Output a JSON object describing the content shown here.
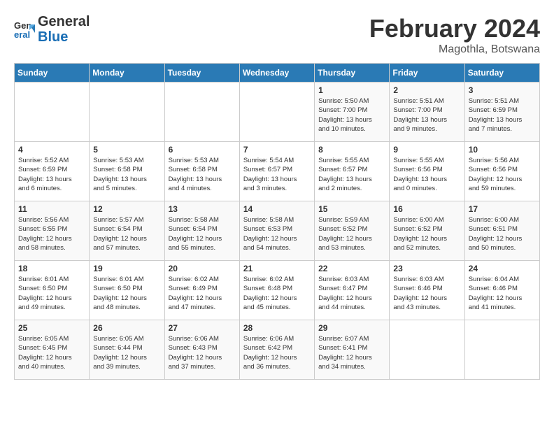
{
  "header": {
    "logo_general": "General",
    "logo_blue": "Blue",
    "month_title": "February 2024",
    "location": "Magothla, Botswana"
  },
  "days_of_week": [
    "Sunday",
    "Monday",
    "Tuesday",
    "Wednesday",
    "Thursday",
    "Friday",
    "Saturday"
  ],
  "weeks": [
    [
      {
        "day": "",
        "info": ""
      },
      {
        "day": "",
        "info": ""
      },
      {
        "day": "",
        "info": ""
      },
      {
        "day": "",
        "info": ""
      },
      {
        "day": "1",
        "info": "Sunrise: 5:50 AM\nSunset: 7:00 PM\nDaylight: 13 hours\nand 10 minutes."
      },
      {
        "day": "2",
        "info": "Sunrise: 5:51 AM\nSunset: 7:00 PM\nDaylight: 13 hours\nand 9 minutes."
      },
      {
        "day": "3",
        "info": "Sunrise: 5:51 AM\nSunset: 6:59 PM\nDaylight: 13 hours\nand 7 minutes."
      }
    ],
    [
      {
        "day": "4",
        "info": "Sunrise: 5:52 AM\nSunset: 6:59 PM\nDaylight: 13 hours\nand 6 minutes."
      },
      {
        "day": "5",
        "info": "Sunrise: 5:53 AM\nSunset: 6:58 PM\nDaylight: 13 hours\nand 5 minutes."
      },
      {
        "day": "6",
        "info": "Sunrise: 5:53 AM\nSunset: 6:58 PM\nDaylight: 13 hours\nand 4 minutes."
      },
      {
        "day": "7",
        "info": "Sunrise: 5:54 AM\nSunset: 6:57 PM\nDaylight: 13 hours\nand 3 minutes."
      },
      {
        "day": "8",
        "info": "Sunrise: 5:55 AM\nSunset: 6:57 PM\nDaylight: 13 hours\nand 2 minutes."
      },
      {
        "day": "9",
        "info": "Sunrise: 5:55 AM\nSunset: 6:56 PM\nDaylight: 13 hours\nand 0 minutes."
      },
      {
        "day": "10",
        "info": "Sunrise: 5:56 AM\nSunset: 6:56 PM\nDaylight: 12 hours\nand 59 minutes."
      }
    ],
    [
      {
        "day": "11",
        "info": "Sunrise: 5:56 AM\nSunset: 6:55 PM\nDaylight: 12 hours\nand 58 minutes."
      },
      {
        "day": "12",
        "info": "Sunrise: 5:57 AM\nSunset: 6:54 PM\nDaylight: 12 hours\nand 57 minutes."
      },
      {
        "day": "13",
        "info": "Sunrise: 5:58 AM\nSunset: 6:54 PM\nDaylight: 12 hours\nand 55 minutes."
      },
      {
        "day": "14",
        "info": "Sunrise: 5:58 AM\nSunset: 6:53 PM\nDaylight: 12 hours\nand 54 minutes."
      },
      {
        "day": "15",
        "info": "Sunrise: 5:59 AM\nSunset: 6:52 PM\nDaylight: 12 hours\nand 53 minutes."
      },
      {
        "day": "16",
        "info": "Sunrise: 6:00 AM\nSunset: 6:52 PM\nDaylight: 12 hours\nand 52 minutes."
      },
      {
        "day": "17",
        "info": "Sunrise: 6:00 AM\nSunset: 6:51 PM\nDaylight: 12 hours\nand 50 minutes."
      }
    ],
    [
      {
        "day": "18",
        "info": "Sunrise: 6:01 AM\nSunset: 6:50 PM\nDaylight: 12 hours\nand 49 minutes."
      },
      {
        "day": "19",
        "info": "Sunrise: 6:01 AM\nSunset: 6:50 PM\nDaylight: 12 hours\nand 48 minutes."
      },
      {
        "day": "20",
        "info": "Sunrise: 6:02 AM\nSunset: 6:49 PM\nDaylight: 12 hours\nand 47 minutes."
      },
      {
        "day": "21",
        "info": "Sunrise: 6:02 AM\nSunset: 6:48 PM\nDaylight: 12 hours\nand 45 minutes."
      },
      {
        "day": "22",
        "info": "Sunrise: 6:03 AM\nSunset: 6:47 PM\nDaylight: 12 hours\nand 44 minutes."
      },
      {
        "day": "23",
        "info": "Sunrise: 6:03 AM\nSunset: 6:46 PM\nDaylight: 12 hours\nand 43 minutes."
      },
      {
        "day": "24",
        "info": "Sunrise: 6:04 AM\nSunset: 6:46 PM\nDaylight: 12 hours\nand 41 minutes."
      }
    ],
    [
      {
        "day": "25",
        "info": "Sunrise: 6:05 AM\nSunset: 6:45 PM\nDaylight: 12 hours\nand 40 minutes."
      },
      {
        "day": "26",
        "info": "Sunrise: 6:05 AM\nSunset: 6:44 PM\nDaylight: 12 hours\nand 39 minutes."
      },
      {
        "day": "27",
        "info": "Sunrise: 6:06 AM\nSunset: 6:43 PM\nDaylight: 12 hours\nand 37 minutes."
      },
      {
        "day": "28",
        "info": "Sunrise: 6:06 AM\nSunset: 6:42 PM\nDaylight: 12 hours\nand 36 minutes."
      },
      {
        "day": "29",
        "info": "Sunrise: 6:07 AM\nSunset: 6:41 PM\nDaylight: 12 hours\nand 34 minutes."
      },
      {
        "day": "",
        "info": ""
      },
      {
        "day": "",
        "info": ""
      }
    ]
  ]
}
